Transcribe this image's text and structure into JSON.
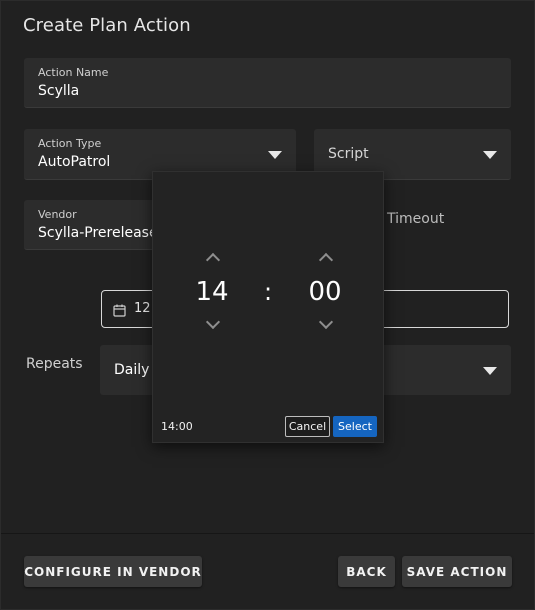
{
  "dialog": {
    "title": "Create Plan Action"
  },
  "form": {
    "action_name": {
      "label": "Action Name",
      "value": "Scylla"
    },
    "action_type": {
      "label": "Action Type",
      "value": "AutoPatrol"
    },
    "script": {
      "placeholder": "Script"
    },
    "vendor": {
      "label": "Vendor",
      "value": "Scylla-Prerelease"
    },
    "timeout": {
      "label": "Timeout"
    },
    "time": {
      "value": "12:"
    },
    "repeats": {
      "label": "Repeats",
      "value": "Daily"
    }
  },
  "time_picker": {
    "hours": "14",
    "separator": ":",
    "minutes": "00",
    "current_value": "14:00",
    "cancel_label": "Cancel",
    "select_label": "Select"
  },
  "footer": {
    "configure_label": "CONFIGURE IN VENDOR",
    "back_label": "BACK",
    "save_label": "SAVE ACTION"
  },
  "icons": {
    "calendar": "calendar-icon",
    "dropdown": "caret-down-icon",
    "chevron_up": "chevron-up-icon",
    "chevron_down": "chevron-down-icon"
  },
  "colors": {
    "dialog_bg": "#212121",
    "field_bg": "#2c2c2c",
    "button_bg": "#3a3a3a",
    "select_accent": "#1565c0"
  }
}
